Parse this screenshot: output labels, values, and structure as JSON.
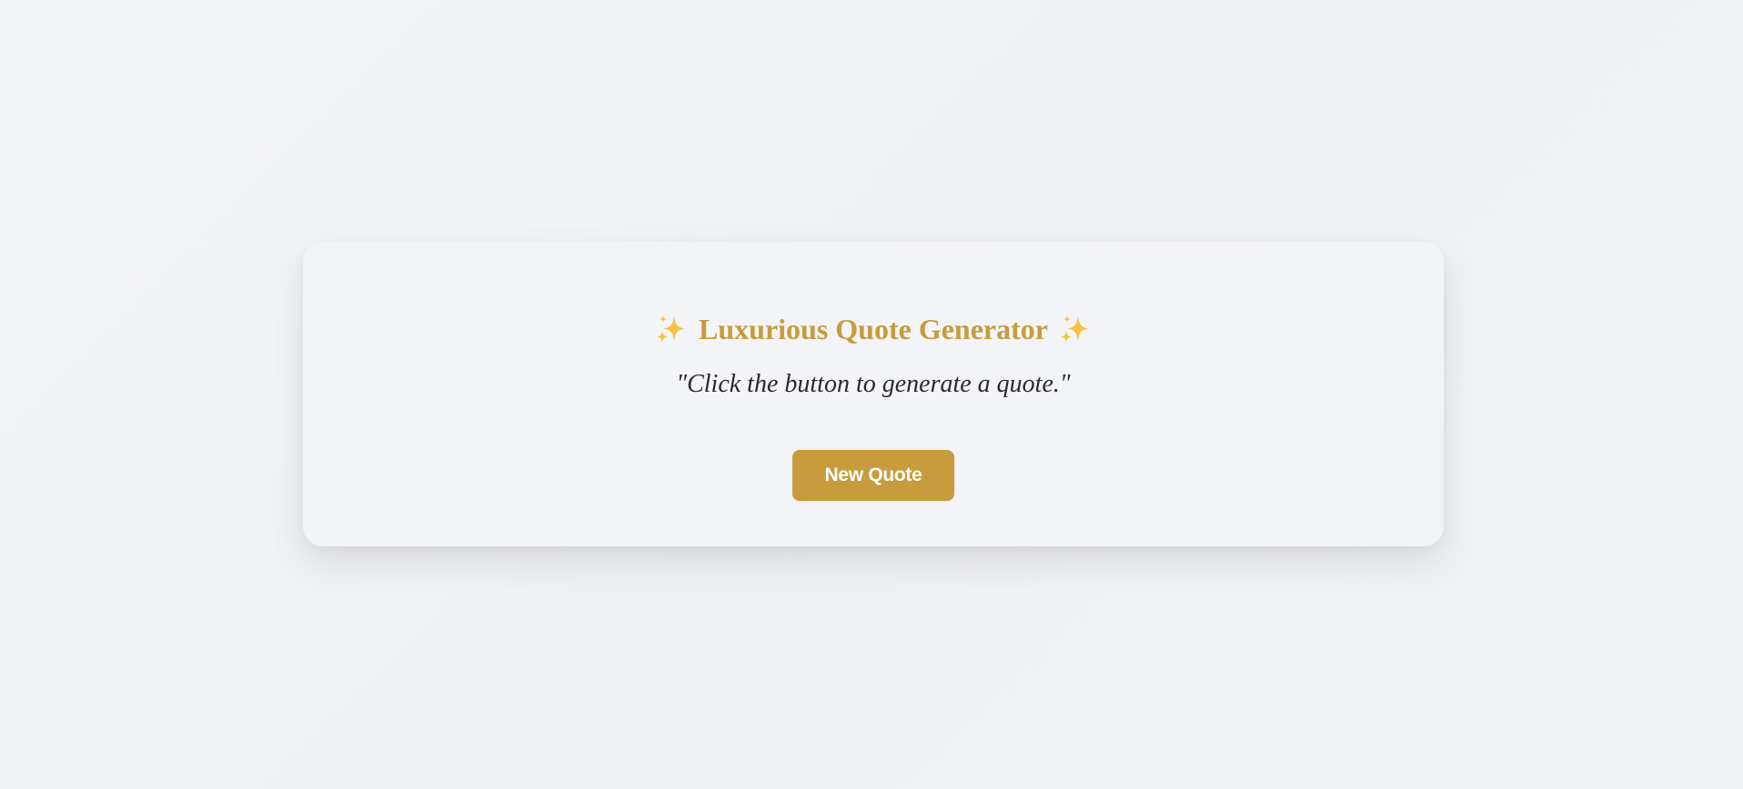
{
  "app": {
    "title": "Luxurious Quote Generator",
    "title_icon_left": "sparkles-icon",
    "title_icon_right": "sparkles-icon",
    "accent_color": "#c89c3c",
    "sparkle_color": "#f7c341"
  },
  "quote": {
    "text": "\"Click the button to generate a quote.\""
  },
  "actions": {
    "new_quote_label": "New Quote"
  }
}
